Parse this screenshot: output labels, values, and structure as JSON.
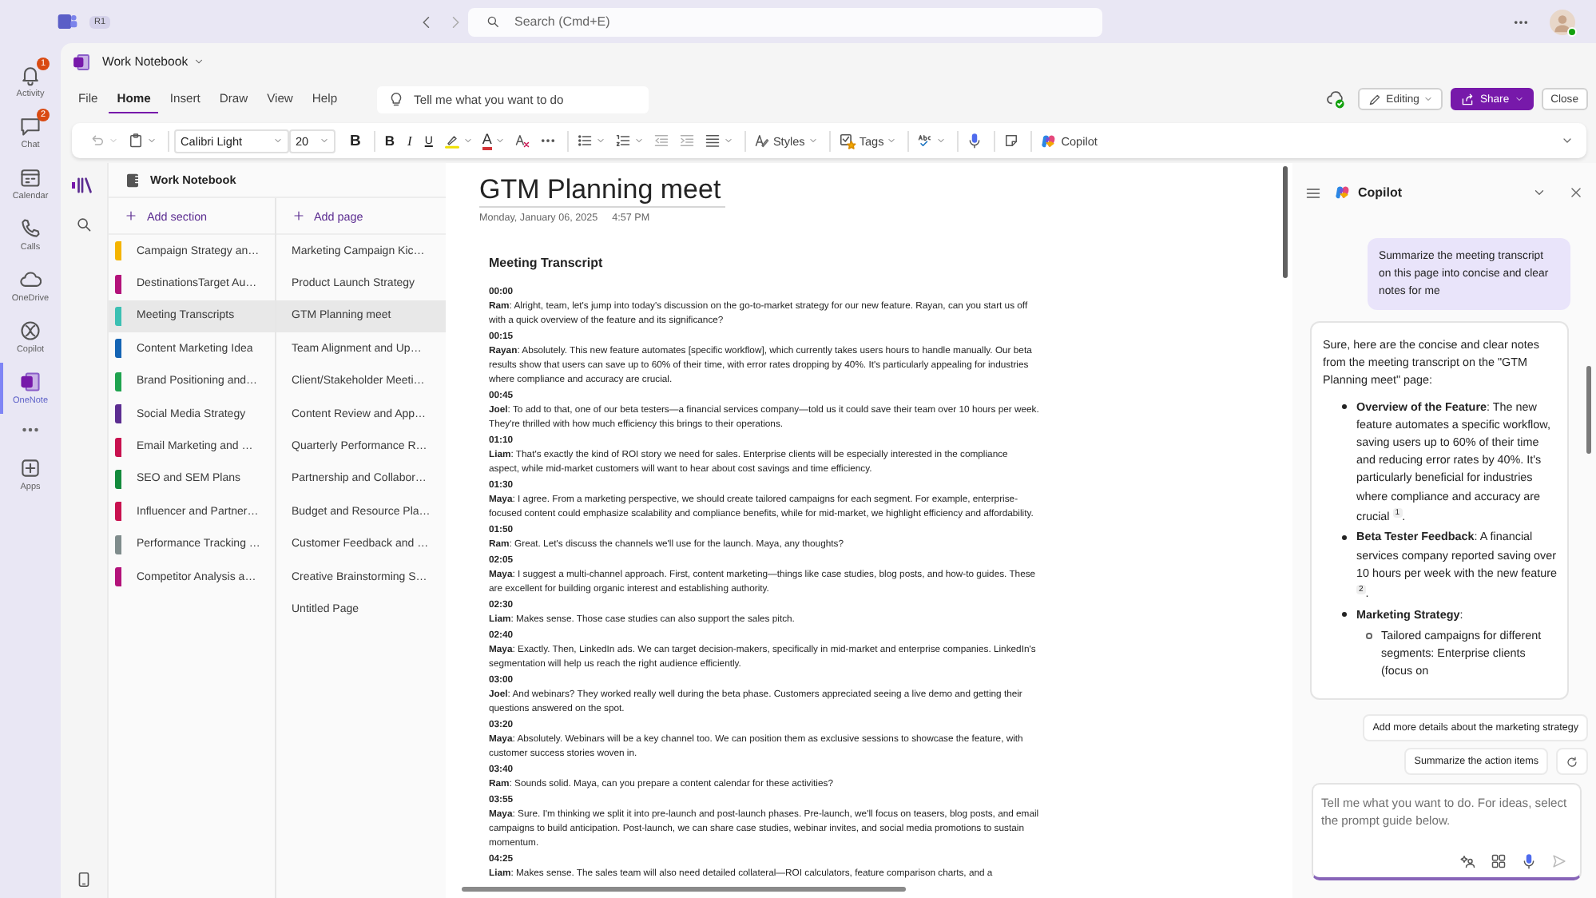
{
  "top_bar": {
    "org_badge": "R1",
    "search": {
      "placeholder": "Search (Cmd+E)"
    }
  },
  "app_rail": {
    "apps": [
      {
        "label": "Activity",
        "badge": "1",
        "selected": false
      },
      {
        "label": "Chat",
        "badge": "2",
        "selected": false
      },
      {
        "label": "Calendar",
        "selected": false
      },
      {
        "label": "Calls",
        "selected": false
      },
      {
        "label": "OneDrive",
        "selected": false
      },
      {
        "label": "Copilot",
        "selected": false
      },
      {
        "label": "OneNote",
        "selected": true
      }
    ],
    "more_apps": {
      "label": "Apps"
    }
  },
  "app": {
    "notebook_title": "Work Notebook",
    "menu_tabs": [
      {
        "label": "File",
        "selected": false
      },
      {
        "label": "Home",
        "selected": true
      },
      {
        "label": "Insert",
        "selected": false
      },
      {
        "label": "Draw",
        "selected": false
      },
      {
        "label": "View",
        "selected": false
      },
      {
        "label": "Help",
        "selected": false
      }
    ],
    "tell_me": {
      "placeholder": "Tell me what you want to do"
    },
    "editing": "Editing",
    "share": "Share",
    "close": "Close"
  },
  "toolbar": {
    "font": "Calibri Light",
    "pt": "20",
    "bold_alt": "B",
    "bold": "B",
    "italic": "I",
    "underline": "U",
    "font_color": "A",
    "styles": "Styles",
    "tags": "Tags",
    "copilot": "Copilot"
  },
  "notebook_pane": {
    "title": "Work Notebook",
    "add_section": "Add section",
    "add_page": "Add page",
    "sections": [
      {
        "label": "Campaign Strategy an…",
        "color": "#f4b400",
        "selected": false
      },
      {
        "label": "DestinationsTarget Au…",
        "color": "#b3127a",
        "selected": false
      },
      {
        "label": "Meeting Transcripts",
        "color": "#3cc0b3",
        "selected": true
      },
      {
        "label": "Content Marketing Idea",
        "color": "#1464b4",
        "selected": false
      },
      {
        "label": "Brand Positioning and…",
        "color": "#1fa34f",
        "selected": false
      },
      {
        "label": "Social Media Strategy",
        "color": "#5c2d91",
        "selected": false
      },
      {
        "label": "Email Marketing and …",
        "color": "#c8114f",
        "selected": false
      },
      {
        "label": "SEO and SEM Plans",
        "color": "#138a3c",
        "selected": false
      },
      {
        "label": "Influencer and Partner…",
        "color": "#c8114f",
        "selected": false
      },
      {
        "label": "Performance Tracking …",
        "color": "#7f8c8c",
        "selected": false
      },
      {
        "label": "Competitor Analysis a…",
        "color": "#b3127a",
        "selected": false
      }
    ],
    "pages": [
      {
        "label": "Marketing Campaign Kic…",
        "selected": false
      },
      {
        "label": "Product Launch Strategy",
        "selected": false
      },
      {
        "label": "GTM Planning meet",
        "selected": true
      },
      {
        "label": "Team Alignment and Up…",
        "selected": false
      },
      {
        "label": "Client/Stakeholder Meeti…",
        "selected": false
      },
      {
        "label": "Content Review and App…",
        "selected": false
      },
      {
        "label": "Quarterly Performance R…",
        "selected": false
      },
      {
        "label": "Partnership and Collabor…",
        "selected": false
      },
      {
        "label": "Budget and Resource Pla…",
        "selected": false
      },
      {
        "label": "Customer Feedback and …",
        "selected": false
      },
      {
        "label": "Creative Brainstorming S…",
        "selected": false
      },
      {
        "label": "Untitled Page",
        "selected": false
      }
    ]
  },
  "page": {
    "title": "GTM Planning meet",
    "date": "Monday, January 06, 2025",
    "time": "4:57 PM",
    "heading": "Meeting Transcript",
    "entries": [
      {
        "time": "00:00",
        "text": "**Ram**: Alright, team, let's jump into today's discussion on the go-to-market strategy for our new feature. Rayan, can you start us off with a quick overview of the feature and its significance?"
      },
      {
        "time": "00:15",
        "text": "**Rayan**: Absolutely. This new feature automates [specific workflow], which currently takes users hours to handle manually. Our beta results show that users can save up to 60% of their time, with error rates dropping by 40%. It's particularly appealing for industries where compliance and accuracy are crucial."
      },
      {
        "time": "00:45",
        "text": "**Joel**: To add to that, one of our beta testers—a financial services company—told us it could save their team over 10 hours per week. They're thrilled with how much efficiency this brings to their operations."
      },
      {
        "time": "01:10",
        "text": "**Liam**: That's exactly the kind of ROI story we need for sales. Enterprise clients will be especially interested in the compliance aspect, while mid-market customers will want to hear about cost savings and time efficiency."
      },
      {
        "time": "01:30",
        "text": "**Maya**: I agree. From a marketing perspective, we should create tailored campaigns for each segment. For example, enterprise-focused content could emphasize scalability and compliance benefits, while for mid-market, we highlight efficiency and affordability."
      },
      {
        "time": "01:50",
        "text": "**Ram**: Great. Let's discuss the channels we'll use for the launch. Maya, any thoughts?"
      },
      {
        "time": "02:05",
        "text": "**Maya**: I suggest a multi-channel approach. First, content marketing—things like case studies, blog posts, and how-to guides. These are excellent for building organic interest and establishing authority."
      },
      {
        "time": "02:30",
        "text": "**Liam**: Makes sense. Those case studies can also support the sales pitch."
      },
      {
        "time": "02:40",
        "text": "**Maya**: Exactly. Then, LinkedIn ads. We can target decision-makers, specifically in mid-market and enterprise companies. LinkedIn's segmentation will help us reach the right audience efficiently."
      },
      {
        "time": "03:00",
        "text": "**Joel**: And webinars? They worked really well during the beta phase. Customers appreciated seeing a live demo and getting their questions answered on the spot."
      },
      {
        "time": "03:20",
        "text": "**Maya**: Absolutely. Webinars will be a key channel too. We can position them as exclusive sessions to showcase the feature, with customer success stories woven in."
      },
      {
        "time": "03:40",
        "text": "**Ram**: Sounds solid. Maya, can you prepare a content calendar for these activities?"
      },
      {
        "time": "03:55",
        "text": "**Maya**: Sure. I'm thinking we split it into pre-launch and post-launch phases. Pre-launch, we'll focus on teasers, blog posts, and email campaigns to build anticipation. Post-launch, we can share case studies, webinar invites, and social media promotions to sustain momentum."
      },
      {
        "time": "04:25",
        "text": "**Liam**: Makes sense. The sales team will also need detailed collateral—ROI calculators, feature comparison charts, and a"
      }
    ]
  },
  "copilot": {
    "title": "Copilot",
    "user_message": "Summarize the meeting transcript on this page into concise and clear notes for me",
    "response": {
      "intro": "Sure, here are the concise and clear notes from the meeting transcript on the \"GTM Planning meet\" page:",
      "bullets": [
        {
          "text": "**Overview of the Feature**: The new feature automates a specific workflow, saving users up to 60% of their time and reducing error rates by 40%. It's particularly beneficial for industries where compliance and accuracy are crucial $^{1}$."
        },
        {
          "text": "**Beta Tester Feedback**: A financial services company reported saving over 10 hours per week with the new feature $^{2}$."
        },
        {
          "text": "**Marketing Strategy**:",
          "children": [
            {
              "text": "Tailored campaigns for different segments: Enterprise clients (focus on"
            }
          ]
        }
      ]
    },
    "suggestions": [
      "Add more details about the marketing strategy",
      "Summarize the action items"
    ],
    "input": {
      "placeholder": "Tell me what you want to do. For ideas, select the prompt guide below."
    }
  }
}
